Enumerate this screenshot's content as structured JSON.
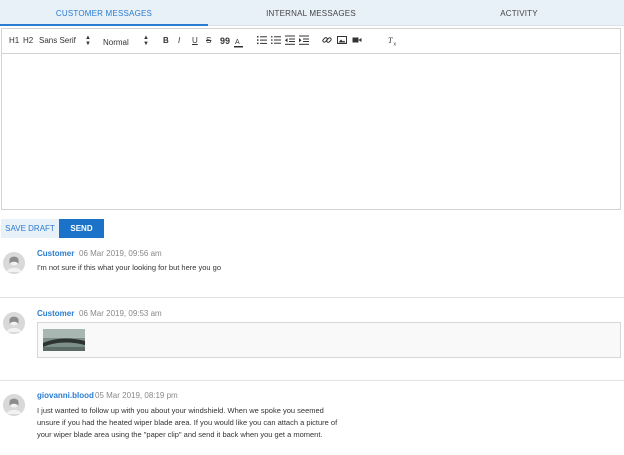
{
  "tabs": [
    {
      "label": "CUSTOMER MESSAGES",
      "active": true
    },
    {
      "label": "INTERNAL MESSAGES",
      "active": false
    },
    {
      "label": "ACTIVITY",
      "active": false
    }
  ],
  "toolbar": {
    "h1_label": "H1",
    "h2_label": "H2",
    "font_family": "Sans Serif",
    "font_size": "Normal",
    "bold_label": "B",
    "italic_label": "I",
    "underline_label": "U",
    "strike_label": "S",
    "quote_label": "99"
  },
  "actions": {
    "save_draft_label": "SAVE DRAFT",
    "send_label": "SEND"
  },
  "messages": [
    {
      "author": "Customer",
      "time": "06 Mar 2019, 09:56 am",
      "text": "I'm not sure if this what your looking for but here you go"
    },
    {
      "author": "Customer",
      "time": "06 Mar 2019, 09:53 am",
      "text": ""
    },
    {
      "author": "giovanni.blood",
      "time": "05 Mar 2019, 08:19 pm",
      "lines": [
        "I just wanted to follow up with you about your windshield. When we spoke you seemed",
        "unsure if you had the heated wiper blade area. If you would like you can attach a picture of",
        "your wiper blade area using the \"paper clip\" and send it back when you get a moment."
      ]
    }
  ],
  "colors": {
    "accent": "#2a7cd0",
    "send": "#1a73c8",
    "tab_bg": "#e8f0f8"
  }
}
